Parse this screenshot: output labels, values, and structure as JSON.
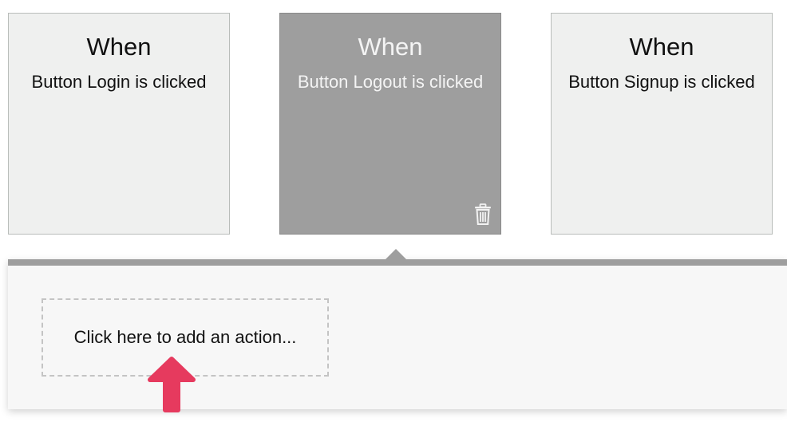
{
  "events": [
    {
      "title": "When",
      "description": "Button Login is clicked",
      "selected": false
    },
    {
      "title": "When",
      "description": "Button Logout is clicked",
      "selected": true
    },
    {
      "title": "When",
      "description": "Button Signup is clicked",
      "selected": false
    }
  ],
  "action_panel": {
    "add_action_label": "Click here to add an action..."
  },
  "icons": {
    "delete": "trash-icon",
    "annotation": "up-arrow-icon"
  },
  "colors": {
    "card_bg": "#eff0ef",
    "card_selected_bg": "#9e9e9e",
    "annotation_arrow": "#e63a5e"
  }
}
